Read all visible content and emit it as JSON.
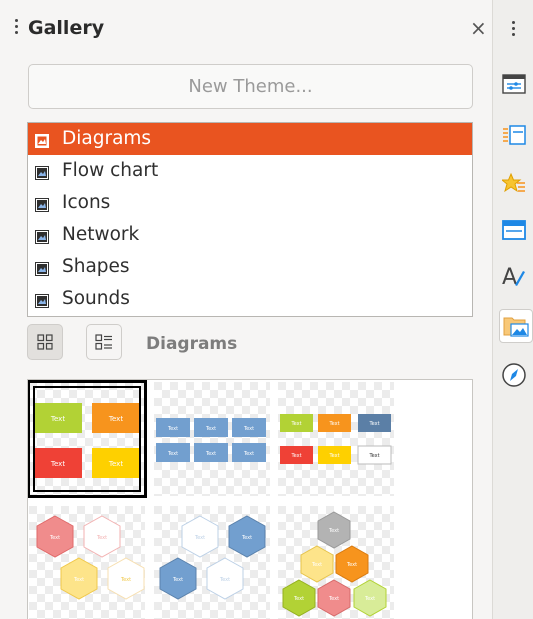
{
  "panel": {
    "title": "Gallery",
    "new_theme_label": "New Theme...",
    "themes": [
      {
        "label": "Diagrams",
        "selected": true
      },
      {
        "label": "Flow chart",
        "selected": false
      },
      {
        "label": "Icons",
        "selected": false
      },
      {
        "label": "Network",
        "selected": false
      },
      {
        "label": "Shapes",
        "selected": false
      },
      {
        "label": "Sounds",
        "selected": false
      }
    ],
    "view_modes": [
      "icon-view",
      "detailed-view"
    ],
    "current_theme": "Diagrams",
    "thumb_text": "Text"
  },
  "sidebar_tabs": [
    "properties-icon",
    "page-icon",
    "styles-icon",
    "stylist-icon",
    "character-icon",
    "gallery-icon",
    "navigator-icon"
  ],
  "colors": {
    "accent": "#e95420",
    "green": "#b2d235",
    "orange": "#f7941d",
    "red": "#ef4136",
    "yellow": "#fed000",
    "blue": "#729fcf"
  }
}
